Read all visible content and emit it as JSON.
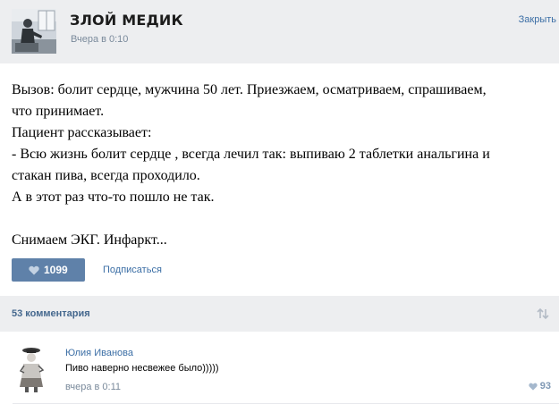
{
  "post": {
    "author": "ЗЛОЙ МЕДИК",
    "date": "Вчера в 0:10",
    "close_label": "Закрыть",
    "lines": [
      "Вызов: болит сердце, мужчина 50 лет. Приезжаем, осматриваем, спрашиваем,",
      "что принимает.",
      "Пациент рассказывает:",
      "- Всю жизнь болит сердце , всегда лечил так: выпиваю 2 таблетки анальгина и",
      "стакан пива, всегда проходило.",
      "А в этот раз что-то пошло не так.",
      "",
      "Снимаем ЭКГ. Инфаркт..."
    ],
    "like_count": "1099",
    "subscribe_label": "Подписаться"
  },
  "comments": {
    "count_label": "53 комментария",
    "items": [
      {
        "author": "Юлия Иванова",
        "text": "Пиво наверно несвежее было)))))",
        "date": "вчера в 0:11",
        "likes": "93"
      }
    ]
  },
  "colors": {
    "header_bg": "#edeef0",
    "like_button": "#5f81a9",
    "link": "#3b6ea5",
    "muted": "#7a8a9b"
  },
  "icons": {
    "like": "heart-icon",
    "sort": "sort-arrows-icon"
  }
}
